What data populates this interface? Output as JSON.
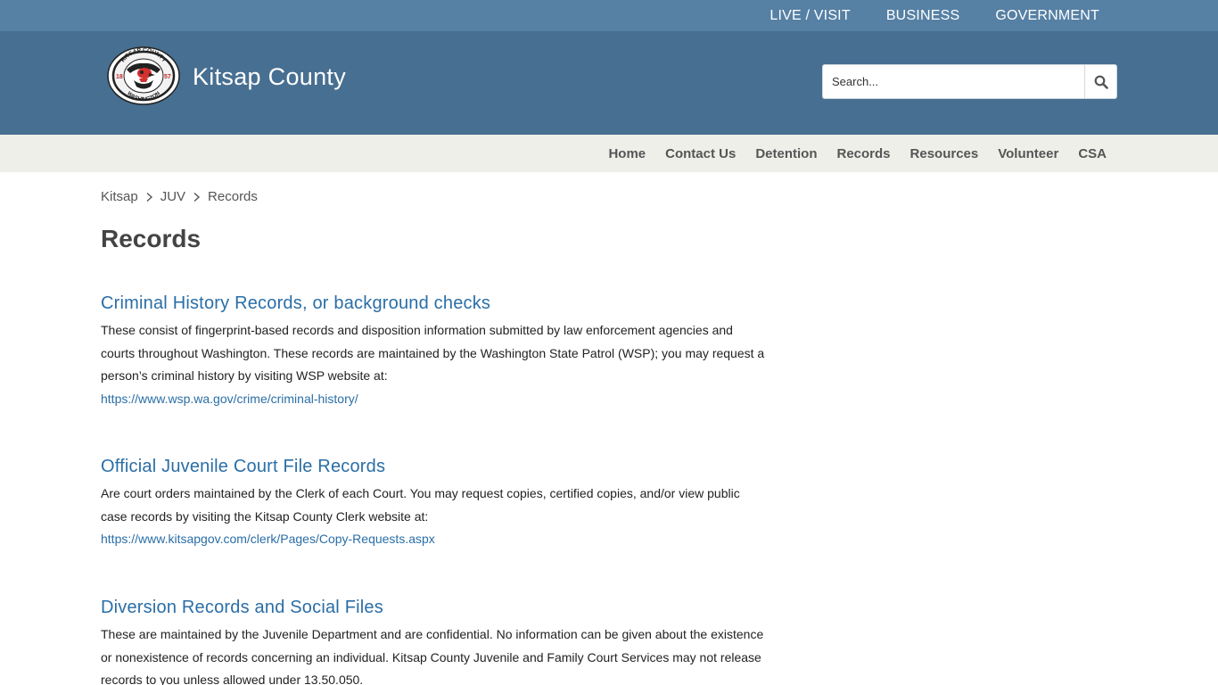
{
  "top_nav": {
    "live_visit": "LIVE / VISIT",
    "business": "BUSINESS",
    "government": "GOVERNMENT"
  },
  "header": {
    "site_title": "Kitsap County",
    "logo": {
      "top_text": "KITSAP COUNTY",
      "bottom_text": "WASHINGTON",
      "year_left": "18",
      "year_right": "57"
    },
    "search": {
      "placeholder": "Search...",
      "icon": "search-icon"
    }
  },
  "main_nav": {
    "items": [
      "Home",
      "Contact Us",
      "Detention",
      "Records",
      "Resources",
      "Volunteer",
      "CSA"
    ]
  },
  "breadcrumb": {
    "items": [
      "Kitsap",
      "JUV",
      "Records"
    ]
  },
  "page_title": "Records",
  "sections": [
    {
      "heading": "Criminal History Records, or background checks",
      "body": "These consist of fingerprint-based records and disposition information submitted by law enforcement agencies and courts throughout Washington.  These records are maintained by the Washington State Patrol (WSP); you may request a person’s criminal history by visiting WSP website at:",
      "link": "https://www.wsp.wa.gov/crime/criminal-history/"
    },
    {
      "heading": "Official Juvenile Court File Records",
      "body": "Are court orders maintained by the Clerk of each Court.  You may request copies, certified copies, and/or view public case records by visiting the Kitsap County Clerk website at:",
      "link": "https://www.kitsapgov.com/clerk/Pages/Copy-Requests.aspx"
    },
    {
      "heading": "Diversion Records and Social Files",
      "body": "These are maintained by the Juvenile Department and are confidential.  No information can be given about the existence or nonexistence of records concerning an individual.  Kitsap County Juvenile and Family Court Services may not release records to you unless allowed under 13.50.050."
    }
  ],
  "colors": {
    "top_bar": "#5680a4",
    "header": "#476f91",
    "nav_bar": "#efefea",
    "link": "#2a6ea6",
    "logo_red": "#d32f2f"
  }
}
